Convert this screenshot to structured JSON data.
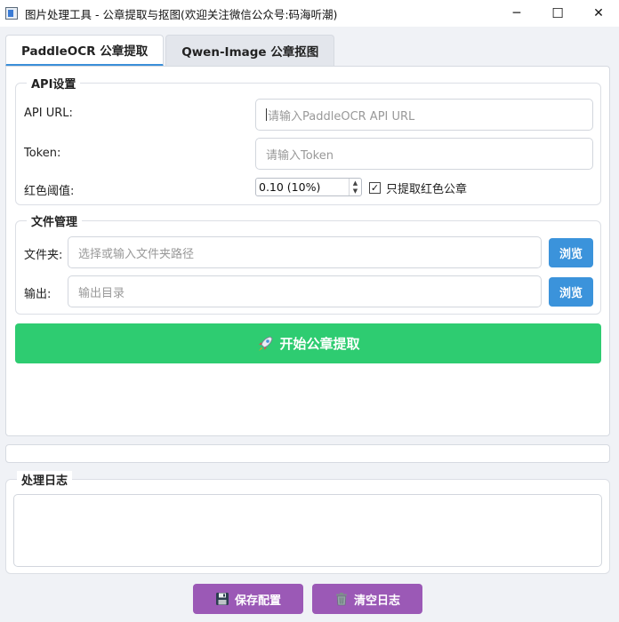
{
  "window": {
    "title": "图片处理工具 - 公章提取与抠图(欢迎关注微信公众号:码海听潮)",
    "minimize": "─",
    "maximize": "☐",
    "close": "✕"
  },
  "tabs": [
    {
      "label": "PaddleOCR 公章提取",
      "active": true
    },
    {
      "label": "Qwen-Image 公章抠图",
      "active": false
    }
  ],
  "api_settings": {
    "title": "API设置",
    "api_url_label": "API URL:",
    "api_url_placeholder": "请输入PaddleOCR API URL",
    "token_label": "Token:",
    "token_placeholder": "请输入Token",
    "threshold_label": "红色阈值:",
    "threshold_value": "0.10 (10%)",
    "red_only_label": "只提取红色公章",
    "red_only_checked": true
  },
  "file_management": {
    "title": "文件管理",
    "folder_label": "文件夹:",
    "folder_placeholder": "选择或输入文件夹路径",
    "output_label": "输出:",
    "output_placeholder": "输出目录",
    "browse_label": "浏览"
  },
  "start_button": {
    "label": "开始公章提取",
    "icon": "rocket-icon"
  },
  "log": {
    "title": "处理日志"
  },
  "footer": {
    "save_label": "保存配置",
    "save_icon": "floppy-disk-icon",
    "clear_label": "清空日志",
    "clear_icon": "trash-icon"
  },
  "colors": {
    "accent_blue": "#3b93db",
    "start_green": "#2ecc71",
    "footer_purple": "#9b59b6",
    "tab_underline": "#3b8fd9"
  }
}
